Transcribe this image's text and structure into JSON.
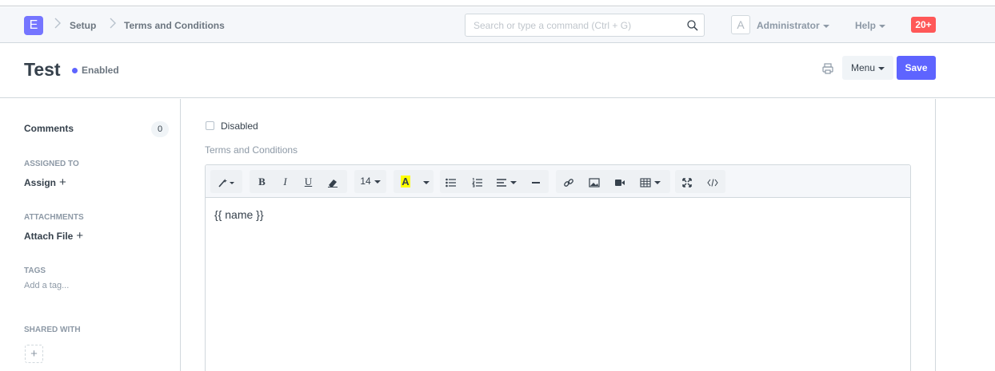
{
  "navbar": {
    "logo_letter": "E",
    "breadcrumbs": [
      "Setup",
      "Terms and Conditions"
    ],
    "search_placeholder": "Search or type a command (Ctrl + G)",
    "avatar_letter": "A",
    "user_label": "Administrator",
    "help_label": "Help",
    "notification_count": "20+"
  },
  "page": {
    "title": "Test",
    "status": "Enabled",
    "menu_label": "Menu",
    "save_label": "Save"
  },
  "sidebar": {
    "comments_label": "Comments",
    "comments_count": "0",
    "assigned_to_label": "ASSIGNED TO",
    "assign_label": "Assign",
    "attachments_label": "ATTACHMENTS",
    "attach_label": "Attach File",
    "tags_label": "TAGS",
    "add_tag_label": "Add a tag...",
    "shared_with_label": "SHARED WITH",
    "plus_glyph": "+"
  },
  "form": {
    "disabled_label": "Disabled",
    "terms_label": "Terms and Conditions",
    "font_size": "14",
    "editor_content": "{{ name }}"
  },
  "toolbar": {
    "bold": "B",
    "italic": "I",
    "underline": "U",
    "highlight": "A"
  },
  "colors": {
    "primary": "#5e64ff",
    "logo": "#7575ff",
    "notification": "#ff5858",
    "highlight": "#ffff00"
  }
}
